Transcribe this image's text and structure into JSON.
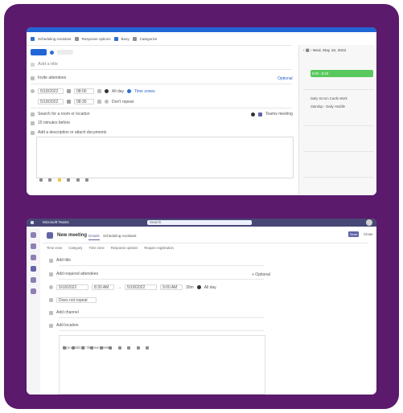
{
  "outlook": {
    "ribbon": {
      "items": [
        "Scheduling Assistant",
        "Response options",
        "Busy",
        "Categorize"
      ]
    },
    "title_placeholder": "Add a title",
    "invite_label": "Invite attendees",
    "optional_label": "Optional",
    "start_date": "5/18/2022",
    "start_time": "08:00",
    "end_date": "5/18/2022",
    "end_time": "08:30",
    "all_day_label": "All day",
    "time_zone_label": "Time zones",
    "repeat_label": "Don't repeat",
    "location_placeholder": "Search for a room or location",
    "teams_label": "Teams meeting",
    "reminder_label": "15 minutes before",
    "body_placeholder": "Add a description or attach documents",
    "date_header": "Wed, May 18, 2022",
    "event_chip": "8:00 - 8:30",
    "event_items": [
      "Daily Scrum Cards Work",
      "Standup - Daily Huddle"
    ]
  },
  "teams": {
    "app_title": "Microsoft Teams",
    "search_placeholder": "Search",
    "meeting_title": "New meeting",
    "tabs": [
      "Details",
      "Scheduling Assistant"
    ],
    "subbar_items": [
      "Time zone",
      "Category",
      "Time zone",
      "Response options",
      "Require registration"
    ],
    "title_placeholder": "Add title",
    "attendees_placeholder": "Add required attendees",
    "optional_label": "+ Optional",
    "start_date": "5/18/2022",
    "start_time": "8:30 AM",
    "end_date": "5/18/2022",
    "end_time": "9:00 AM",
    "duration": "30m",
    "all_day_label": "All day",
    "repeat_label": "Does not repeat",
    "channel_placeholder": "Add channel",
    "location_placeholder": "Add location",
    "body_placeholder": "Type details for this new meeting",
    "send_label": "Send",
    "close_label": "Close"
  },
  "colors": {
    "frame": "#5b1a6b",
    "outlook_blue": "#2266d6",
    "event_green": "#59c95d",
    "teams_header": "#464775",
    "teams_button": "#6264a7"
  }
}
